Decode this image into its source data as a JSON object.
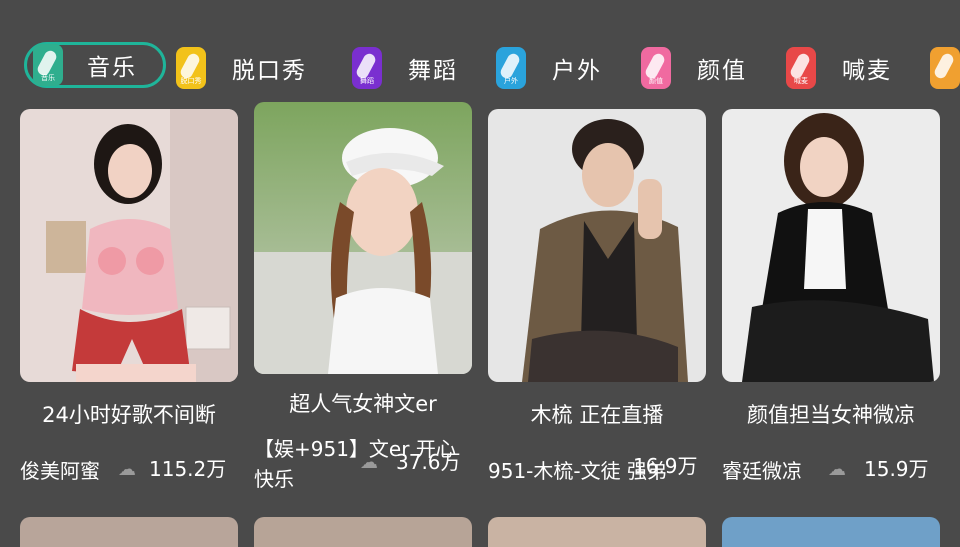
{
  "tabs": [
    {
      "label": "音乐",
      "icon": "feather-music-icon",
      "badge": "音乐",
      "color": "#2fae8e",
      "active": true
    },
    {
      "label": "脱口秀",
      "icon": "mic-talkshow-icon",
      "badge": "脱口秀",
      "color": "#f2c21a",
      "active": false
    },
    {
      "label": "舞蹈",
      "icon": "dance-icon",
      "badge": "舞蹈",
      "color": "#7a2fd0",
      "active": false
    },
    {
      "label": "户外",
      "icon": "outdoor-icon",
      "badge": "户外",
      "color": "#2aa3dc",
      "active": false
    },
    {
      "label": "颜值",
      "icon": "beauty-icon",
      "badge": "颜值",
      "color": "#f06aa0",
      "active": false
    },
    {
      "label": "喊麦",
      "icon": "shout-mic-icon",
      "badge": "喊麦",
      "color": "#e84848",
      "active": false
    }
  ],
  "cards": [
    {
      "title": "24小时好歌不间断",
      "anchor": "俊美阿蜜",
      "heat": "115.2万"
    },
    {
      "title": "超人气女神文er",
      "anchor": "【娱+951】文er 开心快乐",
      "heat": "37.6万"
    },
    {
      "title": "木梳 正在直播",
      "anchor": "951-木梳-文徒 强弟",
      "heat": "16.9万"
    },
    {
      "title": "颜值担当女神微凉",
      "anchor": "睿廷微凉",
      "heat": "15.9万"
    }
  ],
  "icons": {
    "heat": "fire-heat-icon"
  }
}
